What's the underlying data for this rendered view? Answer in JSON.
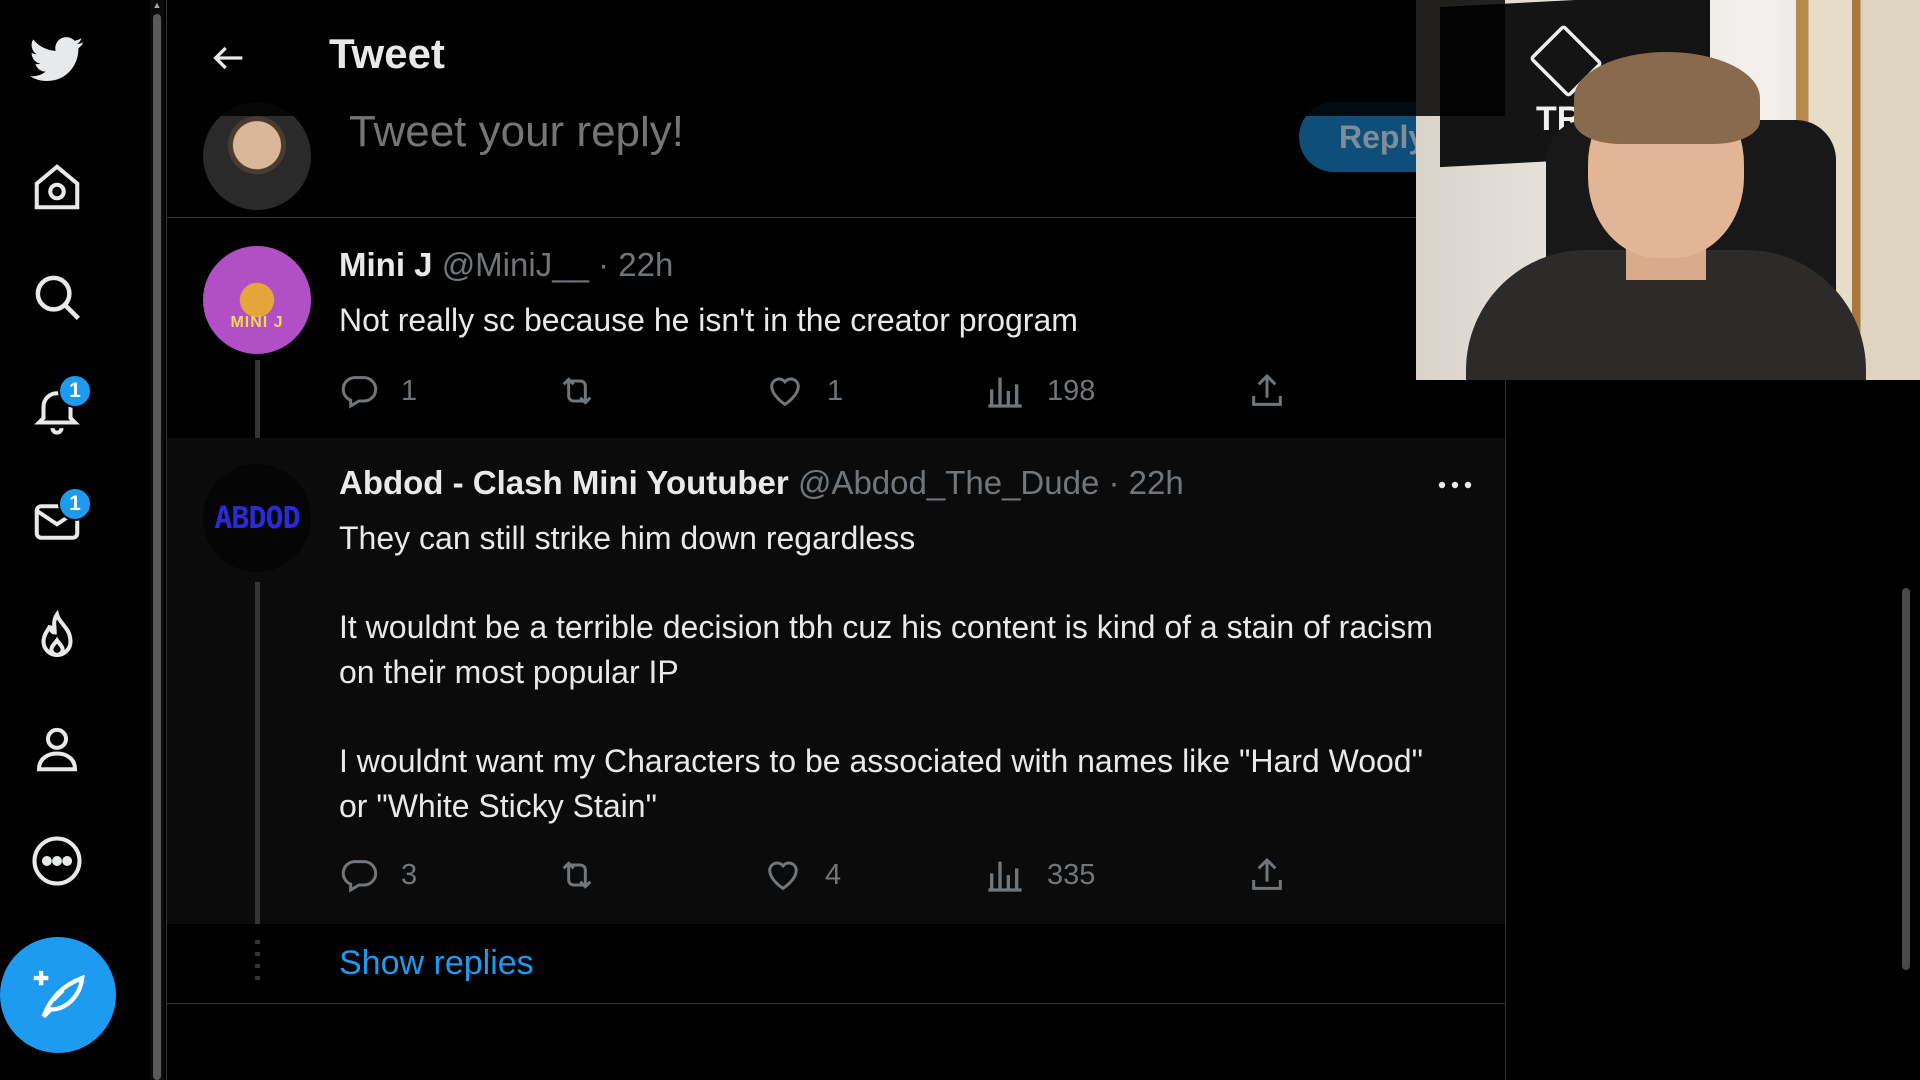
{
  "header": {
    "title": "Tweet"
  },
  "composer": {
    "placeholder": "Tweet your reply!",
    "reply_label": "Reply"
  },
  "nav": {
    "notifications_badge": "1",
    "messages_badge": "1"
  },
  "tweets": [
    {
      "display_name": "Mini J",
      "handle": "@MiniJ__",
      "separator": "·",
      "time": "22h",
      "avatar_text": "MINI J",
      "body": [
        "Not really sc because he isn't in the creator program"
      ],
      "replies": "1",
      "retweets": "",
      "likes": "1",
      "views": "198"
    },
    {
      "display_name": "Abdod - Clash Mini Youtuber",
      "handle": "@Abdod_The_Dude",
      "separator": "·",
      "time": "22h",
      "avatar_text": "ABDOD",
      "body": [
        "They can still strike him down regardless",
        "It wouldnt be a terrible decision tbh cuz his content is kind of a stain of racism on their most popular IP",
        "I wouldnt want my Characters to be associated with names like \"Hard Wood\" or \"White Sticky Stain\""
      ],
      "replies": "3",
      "retweets": "",
      "likes": "4",
      "views": "335"
    }
  ],
  "show_replies_label": "Show replies",
  "webcam": {
    "flag_text": "TR"
  },
  "colors": {
    "accent": "#1d9bf0",
    "background": "#000000",
    "muted_text": "#71767b",
    "primary_text": "#e7e9ea",
    "border": "#2f3336"
  }
}
